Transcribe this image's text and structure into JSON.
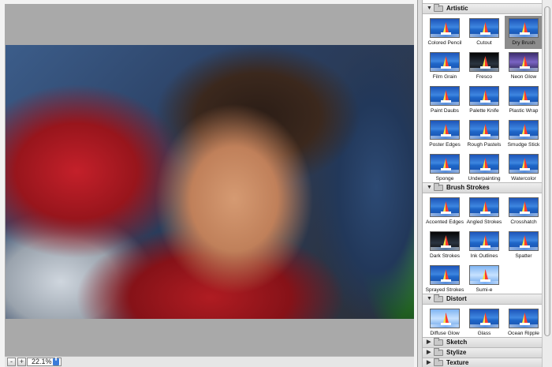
{
  "statusbar": {
    "zoom_out_label": "-",
    "zoom_in_label": "+",
    "zoom_value": "22.1%",
    "zoom_stepper_glyph": "⬍"
  },
  "categories": [
    {
      "label": "Artistic",
      "expanded": true,
      "filters": [
        "Colored Pencil",
        "Cutout",
        "Dry Brush",
        "Film Grain",
        "Fresco",
        "Neon Glow",
        "Paint Daubs",
        "Palette Knife",
        "Plastic Wrap",
        "Poster Edges",
        "Rough Pastels",
        "Smudge Stick",
        "Sponge",
        "Underpainting",
        "Watercolor"
      ],
      "selected": "Dry Brush"
    },
    {
      "label": "Brush Strokes",
      "expanded": true,
      "filters": [
        "Accented Edges",
        "Angled Strokes",
        "Crosshatch",
        "Dark Strokes",
        "Ink Outlines",
        "Spatter",
        "Sprayed Strokes",
        "Sumi-e"
      ]
    },
    {
      "label": "Distort",
      "expanded": true,
      "filters": [
        "Diffuse Glow",
        "Glass",
        "Ocean Ripple"
      ]
    },
    {
      "label": "Sketch",
      "expanded": false
    },
    {
      "label": "Stylize",
      "expanded": false
    },
    {
      "label": "Texture",
      "expanded": false
    }
  ],
  "colors": {
    "selected_tile": "#8c8c8c",
    "zoom_stepper": "#3b7cd9"
  }
}
